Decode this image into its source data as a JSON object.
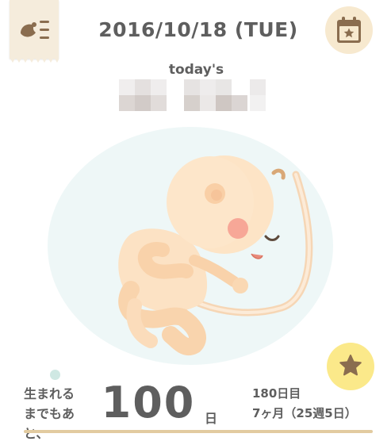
{
  "header": {
    "date": "2016/10/18 (TUE)",
    "menu_icon": "menu-list-icon",
    "calendar_icon": "calendar-star-icon"
  },
  "today": {
    "label": "today's"
  },
  "illustration": {
    "subject": "fetus-illustration"
  },
  "countdown": {
    "label_line1": "生まれる",
    "label_line2": "までもあと、",
    "days": "100",
    "unit": "日",
    "day_number": "180日目",
    "month_week": "7ヶ月（25週5日）"
  },
  "favorite": {
    "icon": "star-icon"
  },
  "colors": {
    "accent": "#e2cba0",
    "star_button": "#fbe98a",
    "calendar_button": "#f7e9cf",
    "menu_tab": "#f5ecdc",
    "text": "#5e5e5e",
    "bubble": "#eef7f7"
  }
}
